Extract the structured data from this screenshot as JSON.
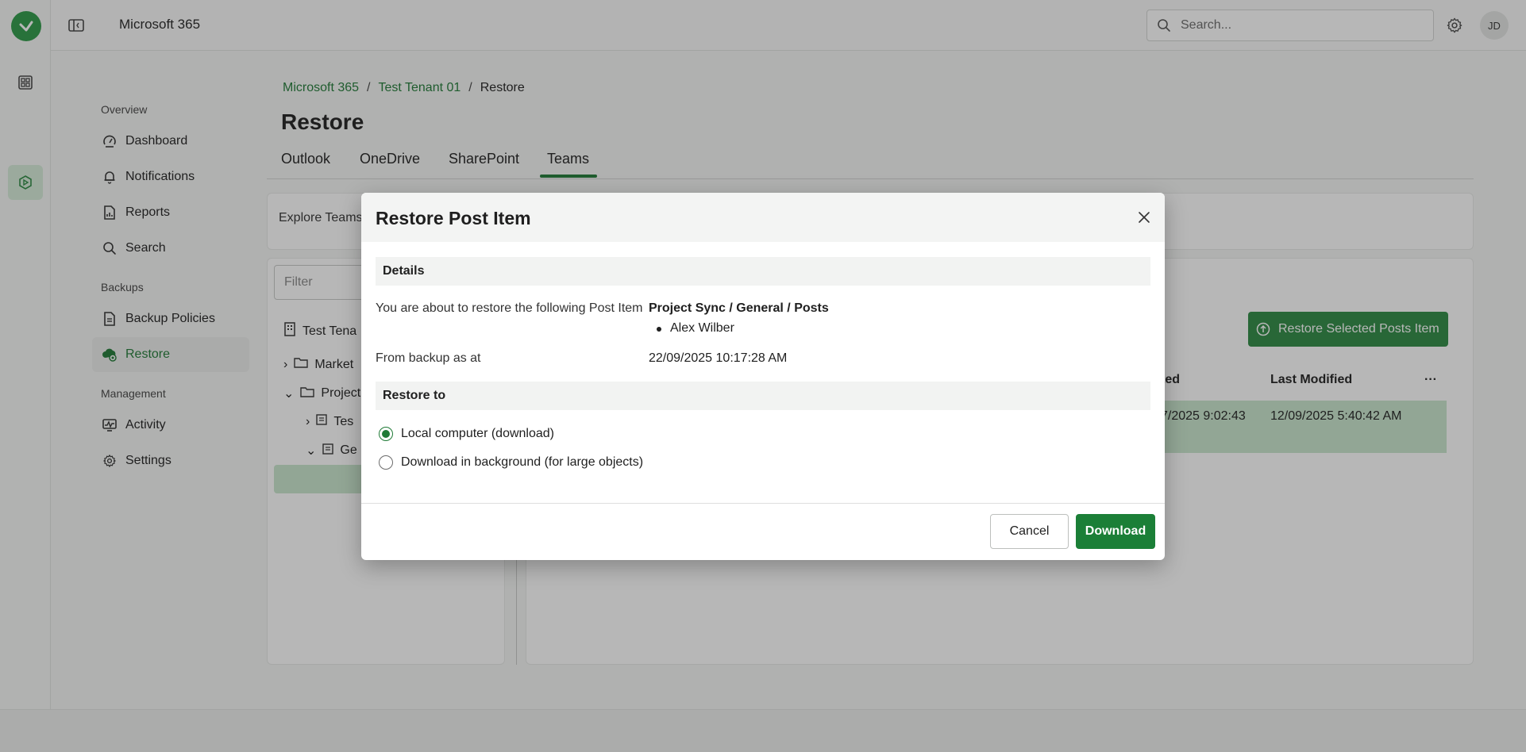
{
  "app": {
    "name": "Microsoft 365",
    "avatar_initials": "JD"
  },
  "search": {
    "placeholder": "Search..."
  },
  "sidebar": {
    "sections": [
      {
        "label": "Overview",
        "items": [
          {
            "label": "Dashboard",
            "icon": "dashboard-icon"
          },
          {
            "label": "Notifications",
            "icon": "bell-icon"
          },
          {
            "label": "Reports",
            "icon": "report-icon"
          },
          {
            "label": "Search",
            "icon": "search-icon"
          }
        ]
      },
      {
        "label": "Backups",
        "items": [
          {
            "label": "Backup Policies",
            "icon": "policy-icon"
          },
          {
            "label": "Restore",
            "icon": "restore-cloud-icon",
            "active": true
          }
        ]
      },
      {
        "label": "Management",
        "items": [
          {
            "label": "Activity",
            "icon": "activity-icon"
          },
          {
            "label": "Settings",
            "icon": "gear-icon"
          }
        ]
      }
    ]
  },
  "breadcrumb": [
    "Microsoft 365",
    "Test Tenant 01",
    "Restore"
  ],
  "page": {
    "title": "Restore"
  },
  "tabs": [
    "Outlook",
    "OneDrive",
    "SharePoint",
    "Teams"
  ],
  "active_tab": "Teams",
  "explore": {
    "label": "Explore Teams"
  },
  "filter": {
    "placeholder": "Filter"
  },
  "tree": [
    "Test Tena",
    "Market",
    "Project",
    "Tes",
    "Ge"
  ],
  "toolbar": {
    "restore_selected_label": "Restore Selected Posts Item"
  },
  "table": {
    "columns": [
      "ted",
      "Last Modified",
      "···"
    ],
    "rows": [
      {
        "created": "7/2025 9:02:43",
        "last_modified": "12/09/2025 5:40:42 AM"
      }
    ]
  },
  "modal": {
    "title": "Restore Post Item",
    "details_heading": "Details",
    "about_label": "You are about to restore the following Post Item",
    "item_path": "Project Sync / General / Posts",
    "item_author": "Alex Wilber",
    "backup_label": "From backup as at",
    "backup_date": "22/09/2025 10:17:28 AM",
    "restore_to_heading": "Restore to",
    "options": [
      {
        "label": "Local computer (download)",
        "selected": true
      },
      {
        "label": "Download in background (for large objects)",
        "selected": false
      }
    ],
    "cancel_label": "Cancel",
    "download_label": "Download"
  },
  "colors": {
    "accent": "#1f7a36",
    "accent_light": "#c9e6cd",
    "primary_button": "#1b7f37"
  }
}
